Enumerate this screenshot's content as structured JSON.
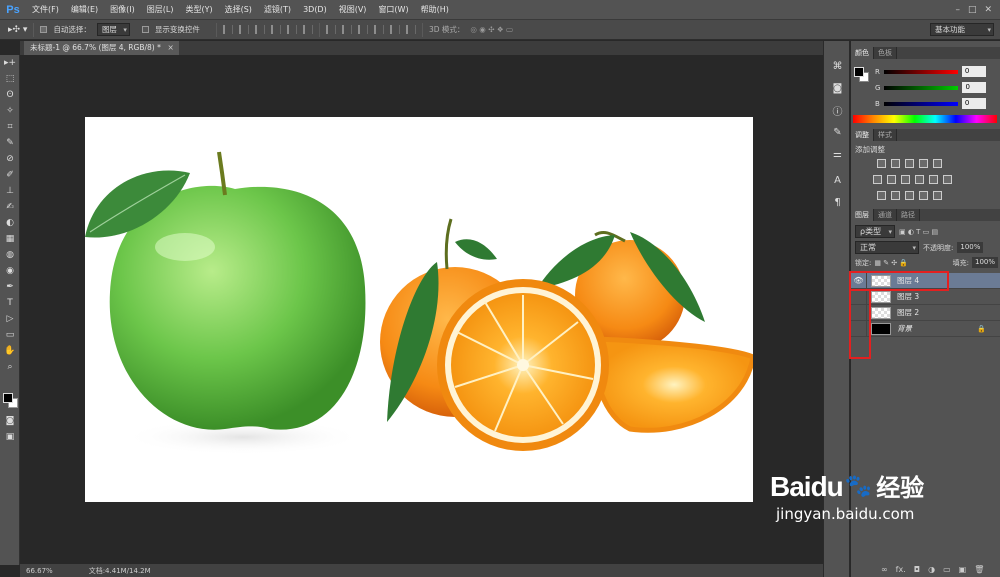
{
  "app": {
    "logo": "Ps"
  },
  "menu": [
    "文件(F)",
    "编辑(E)",
    "图像(I)",
    "图层(L)",
    "类型(Y)",
    "选择(S)",
    "滤镜(T)",
    "3D(D)",
    "视图(V)",
    "窗口(W)",
    "帮助(H)"
  ],
  "window_controls": [
    "–",
    "□",
    "✕"
  ],
  "options": {
    "auto_select_label": "自动选择：",
    "auto_select_value": "图层",
    "show_transform_label": "显示变换控件",
    "mode_3d_label": "3D 模式：",
    "workspace": "基本功能"
  },
  "document": {
    "tab_title": "未标题-1 @ 66.7% (图层 4, RGB/8) *",
    "close": "×"
  },
  "status": {
    "zoom": "66.67%",
    "doc_info": "文档:4.41M/14.2M"
  },
  "tools": [
    "▸+",
    "⬚",
    "ʘ",
    "✧",
    "⌗",
    "✎",
    "⊘",
    "✐",
    "⊥",
    "✍",
    "◐",
    "▦",
    "◍",
    "◉",
    "✒",
    "T",
    "▷",
    "▭",
    "✋",
    "⌕"
  ],
  "panels": {
    "color_tabs": [
      "颜色",
      "色板"
    ],
    "rgb": [
      {
        "label": "R",
        "value": "0"
      },
      {
        "label": "G",
        "value": "0"
      },
      {
        "label": "B",
        "value": "0"
      }
    ],
    "adjust_tabs": [
      "调整",
      "样式"
    ],
    "adjust_title": "添加调整",
    "layers_tabs": [
      "图层",
      "通道",
      "路径"
    ],
    "filter_kind": "ρ类型",
    "blend_mode": "正常",
    "opacity_label": "不透明度:",
    "opacity_value": "100%",
    "lock_label": "锁定:",
    "fill_label": "填充:",
    "fill_value": "100%",
    "layers": [
      {
        "name": "图层 4",
        "visible": true,
        "selected": true
      },
      {
        "name": "图层 3",
        "visible": false,
        "selected": false
      },
      {
        "name": "图层 2",
        "visible": false,
        "selected": false
      },
      {
        "name": "背景",
        "visible": false,
        "selected": false,
        "locked": true
      }
    ],
    "layer_footer": [
      "∞",
      "fx.",
      "◘",
      "◑",
      "▭",
      "▣",
      "🗑"
    ]
  },
  "watermark": {
    "brand": "Baidu",
    "brand_cn": "经验",
    "url": "jingyan.baidu.com"
  },
  "colors": {
    "highlight": "#e32020",
    "selected_layer": "#6b7b95"
  }
}
